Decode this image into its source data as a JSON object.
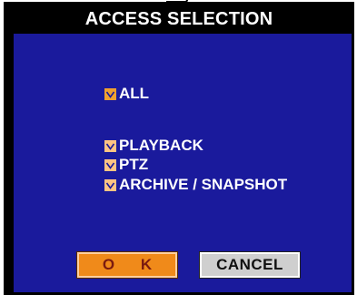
{
  "dialog": {
    "title": "ACCESS SELECTION"
  },
  "options": {
    "all": {
      "label": "ALL",
      "checked": true
    },
    "playback": {
      "label": "PLAYBACK",
      "checked": true
    },
    "ptz": {
      "label": "PTZ",
      "checked": true
    },
    "archive": {
      "label": "ARCHIVE / SNAPSHOT",
      "checked": true
    }
  },
  "buttons": {
    "ok_label": "O K",
    "cancel_label": "CANCEL"
  },
  "colors": {
    "panel": "#1a1a9c",
    "checkbox_primary": "#f0a030",
    "checkbox_secondary": "#ffc383",
    "ok_button": "#f08a1a",
    "cancel_button": "#cfcfcf"
  },
  "icons": {
    "checkmark": "check-icon"
  }
}
